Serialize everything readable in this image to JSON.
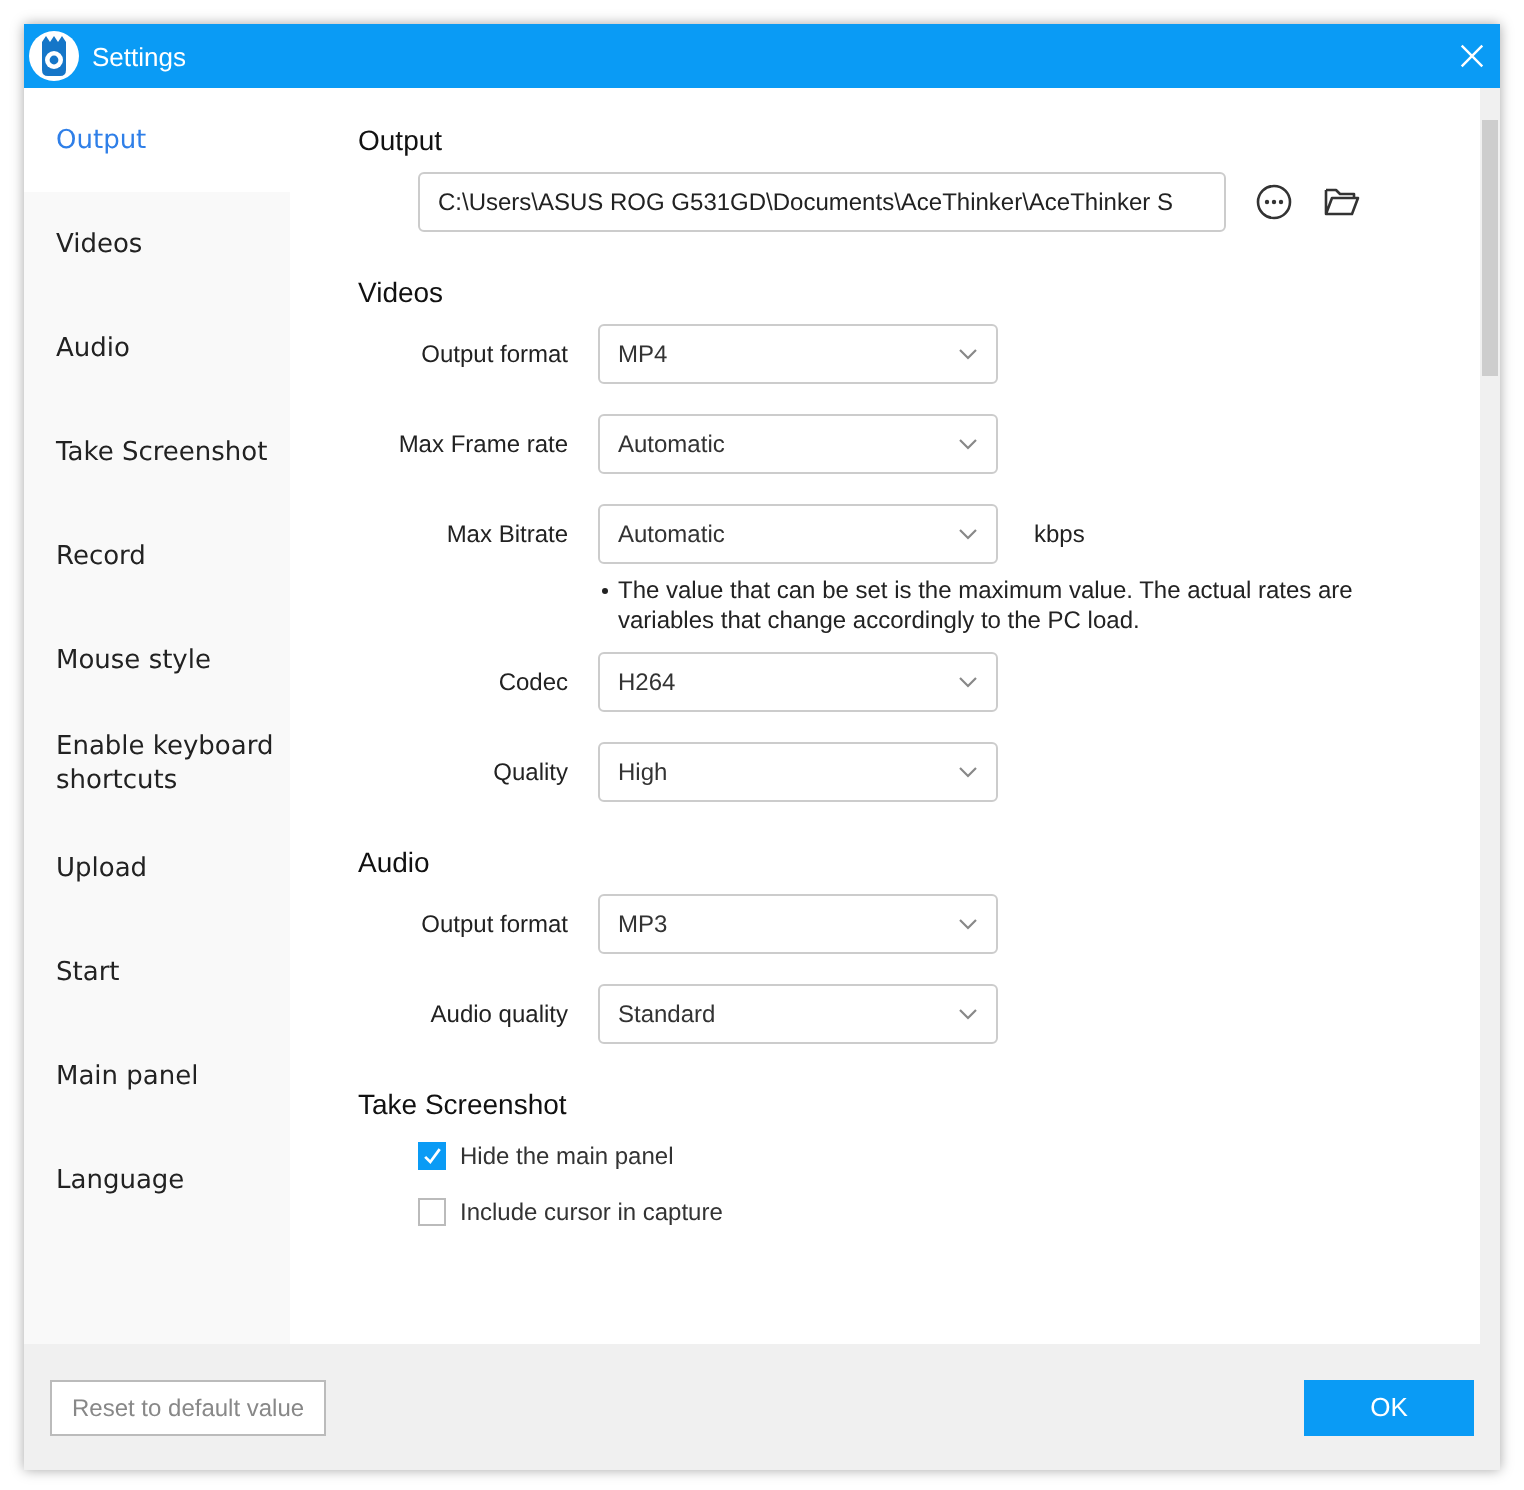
{
  "window": {
    "title": "Settings"
  },
  "sidebar": {
    "items": [
      {
        "label": "Output",
        "selected": true
      },
      {
        "label": "Videos",
        "selected": false
      },
      {
        "label": "Audio",
        "selected": false
      },
      {
        "label": "Take Screenshot",
        "selected": false
      },
      {
        "label": "Record",
        "selected": false
      },
      {
        "label": "Mouse style",
        "selected": false
      },
      {
        "label": "Enable keyboard shortcuts",
        "selected": false
      },
      {
        "label": "Upload",
        "selected": false
      },
      {
        "label": "Start",
        "selected": false
      },
      {
        "label": "Main panel",
        "selected": false
      },
      {
        "label": "Language",
        "selected": false
      }
    ]
  },
  "sections": [
    {
      "kind": "path",
      "title": "Output",
      "path": "C:\\Users\\ASUS ROG G531GD\\Documents\\AceThinker\\AceThinker S"
    },
    {
      "kind": "fields",
      "title": "Videos",
      "fields": [
        {
          "label": "Output format",
          "value": "MP4"
        },
        {
          "label": "Max Frame rate",
          "value": "Automatic"
        },
        {
          "label": "Max Bitrate",
          "value": "Automatic",
          "unit": "kbps",
          "note": "The value that can be set is the maximum value. The actual rates are variables that change accordingly to the PC load."
        },
        {
          "label": "Codec",
          "value": "H264"
        },
        {
          "label": "Quality",
          "value": "High"
        }
      ]
    },
    {
      "kind": "fields",
      "title": "Audio",
      "fields": [
        {
          "label": "Output format",
          "value": "MP3"
        },
        {
          "label": "Audio quality",
          "value": "Standard"
        }
      ]
    },
    {
      "kind": "checks",
      "title": "Take Screenshot",
      "options": [
        {
          "label": "Hide the main panel",
          "checked": true
        },
        {
          "label": "Include cursor in capture",
          "checked": false
        }
      ]
    }
  ],
  "footer": {
    "reset_button": "Reset to default value",
    "ok_button": "OK"
  }
}
